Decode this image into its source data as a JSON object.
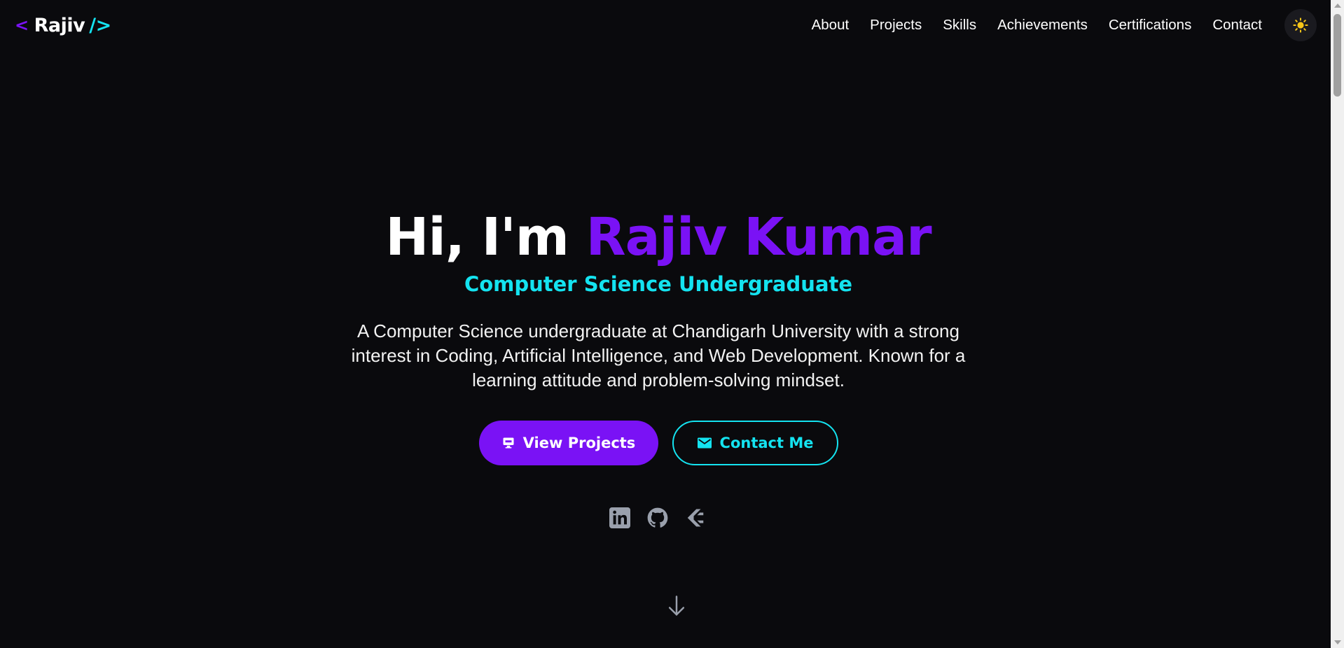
{
  "logo": {
    "open": "<",
    "name": "Rajiv",
    "close": "/>"
  },
  "nav": {
    "items": [
      "About",
      "Projects",
      "Skills",
      "Achievements",
      "Certifications",
      "Contact"
    ],
    "theme_icon": "sun-icon"
  },
  "hero": {
    "greeting": "Hi, I'm ",
    "name": "Rajiv Kumar",
    "subtitle": "Computer Science Undergraduate",
    "description": "A Computer Science undergraduate at Chandigarh University with a strong interest in Coding, Artificial Intelligence, and Web Development. Known for a learning attitude and problem-solving mindset.",
    "primary_button": "View Projects",
    "secondary_button": "Contact Me",
    "socials": [
      "linkedin-icon",
      "github-icon",
      "codechef-icon"
    ]
  },
  "colors": {
    "background": "#0a0a0d",
    "accent_purple": "#7a12f5",
    "accent_cyan": "#14e3f0",
    "sun": "#f5c518",
    "icon_gray": "#9aa0ac"
  }
}
